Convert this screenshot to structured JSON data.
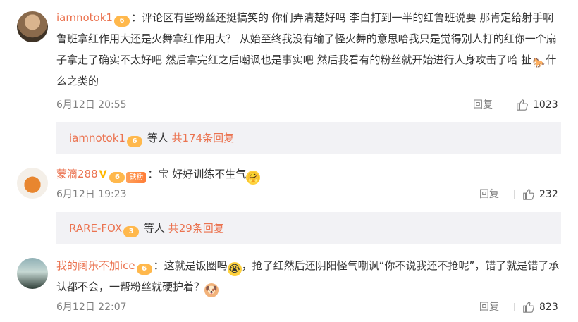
{
  "comments": [
    {
      "username": "iamnotok1",
      "level_badge": "6",
      "text": "：评论区有些粉丝还挺搞笑的 你们弄清楚好吗 李白打到一半的红鲁班说要 那肯定给射手啊 鲁班拿红作用大还是火舞拿红作用大？ 从始至终我没有输了怪火舞的意思哈我只是觉得别人打的红你一个扇子拿走了确实不太好吧 然后拿完红之后嘲讽也是事实吧 然后我看有的粉丝就开始进行人身攻击了哈 扯",
      "text_tail": "什么之类的",
      "inline_emoji": "horse-emoji",
      "date": "6月12日 20:55",
      "reply_label": "回复",
      "likes": "1023",
      "sub_user": "iamnotok1",
      "sub_badge": "6",
      "sub_mid": "等人",
      "sub_more": "共174条回复"
    },
    {
      "username": "蒙滴288",
      "v_badge": "V",
      "level_badge": "6",
      "fan_badge": "铁粉",
      "text": "：宝 好好训练不生气",
      "inline_emoji": "hug-emoji",
      "date": "6月12日 19:23",
      "reply_label": "回复",
      "likes": "232",
      "sub_user": "RARE-FOX",
      "sub_badge": "3",
      "sub_mid": "等人",
      "sub_more": "共29条回复"
    },
    {
      "username": "我的阔乐不加ice",
      "level_badge": "6",
      "text_a": "：这就是饭圈吗",
      "text_b": "，抢了红然后还阴阳怪气嘲讽“你不说我还不抢呢”，错了就是错了承认都不会，一帮粉丝就硬护着？",
      "emoji_a": "crying-emoji",
      "emoji_b": "doge-emoji",
      "date": "6月12日 22:07",
      "reply_label": "回复",
      "likes": "823"
    }
  ],
  "colors": {
    "accent": "#eb7350",
    "meta": "#808080",
    "subbox": "#f2f2f5"
  }
}
